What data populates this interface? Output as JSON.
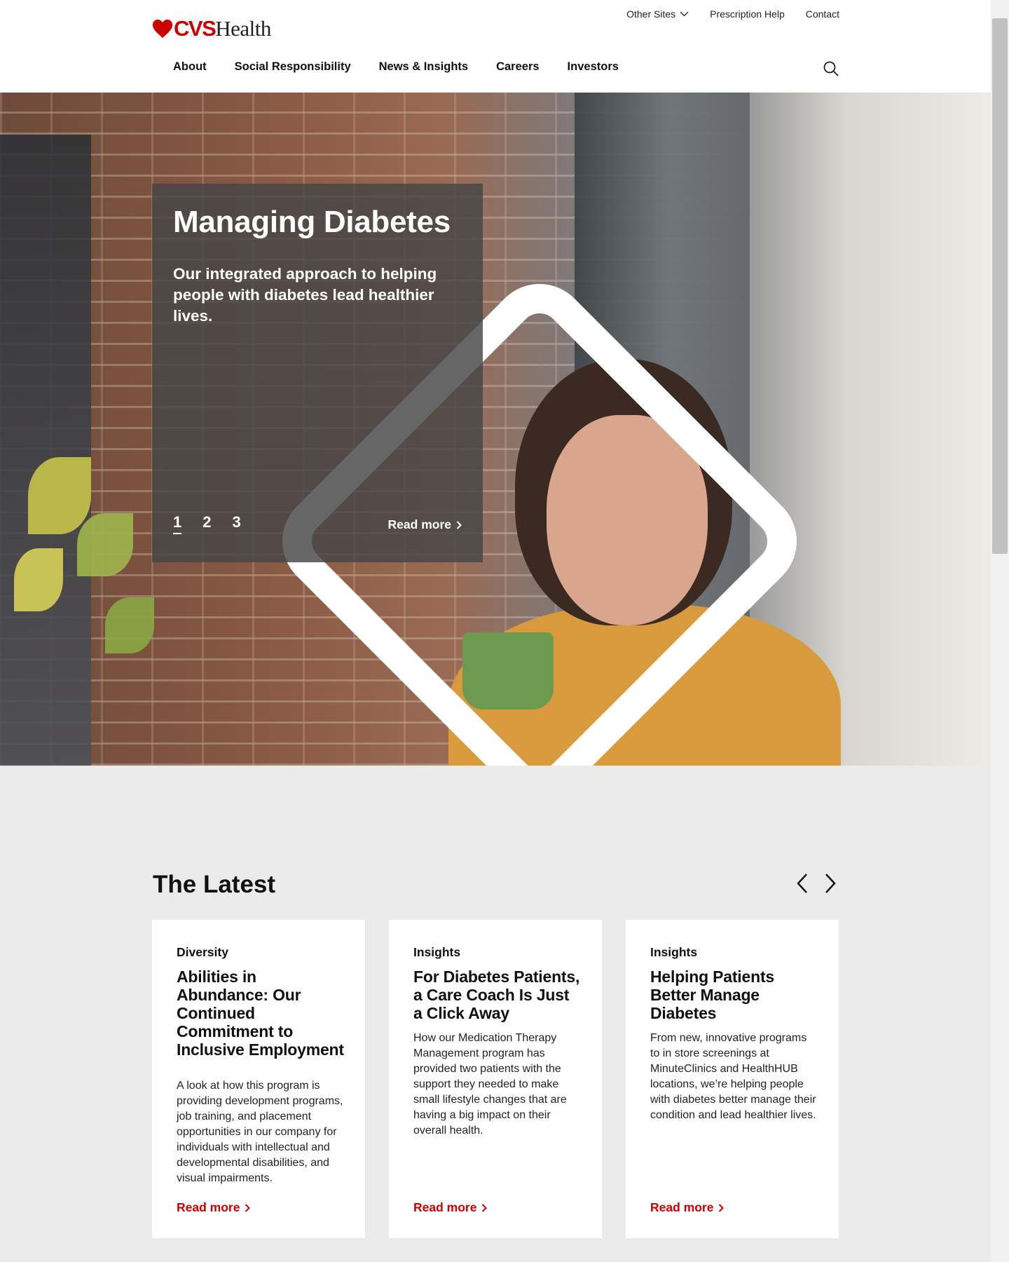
{
  "brand": {
    "logo_cvs": "CVS",
    "logo_health": "Health",
    "accent_color": "#cc0000"
  },
  "utility_nav": {
    "other_sites": "Other Sites",
    "prescription_help": "Prescription Help",
    "contact": "Contact"
  },
  "main_nav": [
    "About",
    "Social Responsibility",
    "News & Insights",
    "Careers",
    "Investors"
  ],
  "icons": {
    "search": "search-icon",
    "dropdown": "chevron-down-icon",
    "prev": "chevron-left-icon",
    "next": "chevron-right-icon"
  },
  "hero": {
    "title": "Managing Diabetes",
    "subtitle": "Our integrated approach to helping people with diabetes lead healthier lives.",
    "pages": [
      "1",
      "2",
      "3"
    ],
    "active_page": "1",
    "read_more": "Read more"
  },
  "latest": {
    "title": "The Latest",
    "cards": [
      {
        "category": "Diversity",
        "title": "Abilities in Abundance: Our Continued Commitment to Inclusive Employment",
        "description": "A look at how this program is providing development programs, job training, and placement opportunities in our company for individuals with intellectual and developmental disabilities, and visual impairments.",
        "read_more": "Read more"
      },
      {
        "category": "Insights",
        "title": "For Diabetes Patients, a Care Coach Is Just a Click Away",
        "description": "How our Medication Therapy Management program has provided two patients with the support they needed to make small lifestyle changes that are having a big impact on their overall health.",
        "read_more": "Read more"
      },
      {
        "category": "Insights",
        "title": "Helping Patients Better Manage Diabetes",
        "description": "From new, innovative programs to in store screenings at MinuteClinics and HealthHUB locations, we’re helping people with diabetes better manage their condition and lead healthier lives.",
        "read_more": "Read more"
      }
    ]
  }
}
